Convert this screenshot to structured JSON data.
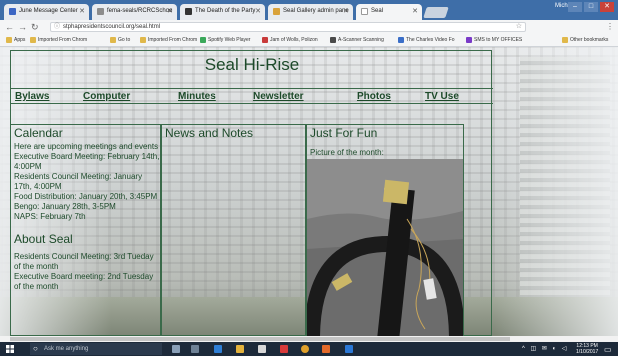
{
  "browser": {
    "tabs": [
      {
        "label": "June Message Center",
        "active": false
      },
      {
        "label": "fema-seals/RCRCSchoo",
        "active": false
      },
      {
        "label": "The Death of the Party",
        "active": false
      },
      {
        "label": "Seal Gallery admin pane",
        "active": false
      },
      {
        "label": "Seal",
        "active": true
      }
    ],
    "user_label": "Michael",
    "address": "stphapresidentscouncil.org/seal.html",
    "bookmarks": [
      "Apps",
      "Imported From Chrom",
      "Go to",
      "Imported From Chrom",
      "Spotify Web Player",
      "Jam of Wolls, Polizon",
      "A-Scanner Scanning",
      "The Charles Video Fo",
      "SMS to MY OFFICES"
    ],
    "bookmarks_other": "Other bookmarks"
  },
  "site": {
    "title": "Seal Hi-Rise",
    "nav": [
      "Bylaws",
      "Computer",
      "Minutes",
      "Newsletter",
      "Photos",
      "TV Use"
    ],
    "calendar": {
      "heading": "Calendar",
      "lines": [
        "Here are upcoming meetings and events",
        "Executive Board Meeting: February 14th, 4:00PM",
        "Residents Council Meeting: January 17th, 4:00PM",
        "Food Distribution: January 20th, 3:45PM",
        "Bengo: January 28th, 3-5PM",
        "NAPS: February 7th"
      ]
    },
    "about": {
      "heading": "About Seal",
      "lines": [
        "Residents Council Meeting: 3rd Tueday of the month",
        "Executive Board meeting: 2nd Tuesday of the month"
      ]
    },
    "news": {
      "heading": "News and Notes"
    },
    "fun": {
      "heading": "Just For Fun",
      "caption": "Picture of the month:"
    }
  },
  "taskbar": {
    "search_placeholder": "Ask me anything",
    "time": "12:13 PM",
    "date": "1/10/2017"
  }
}
